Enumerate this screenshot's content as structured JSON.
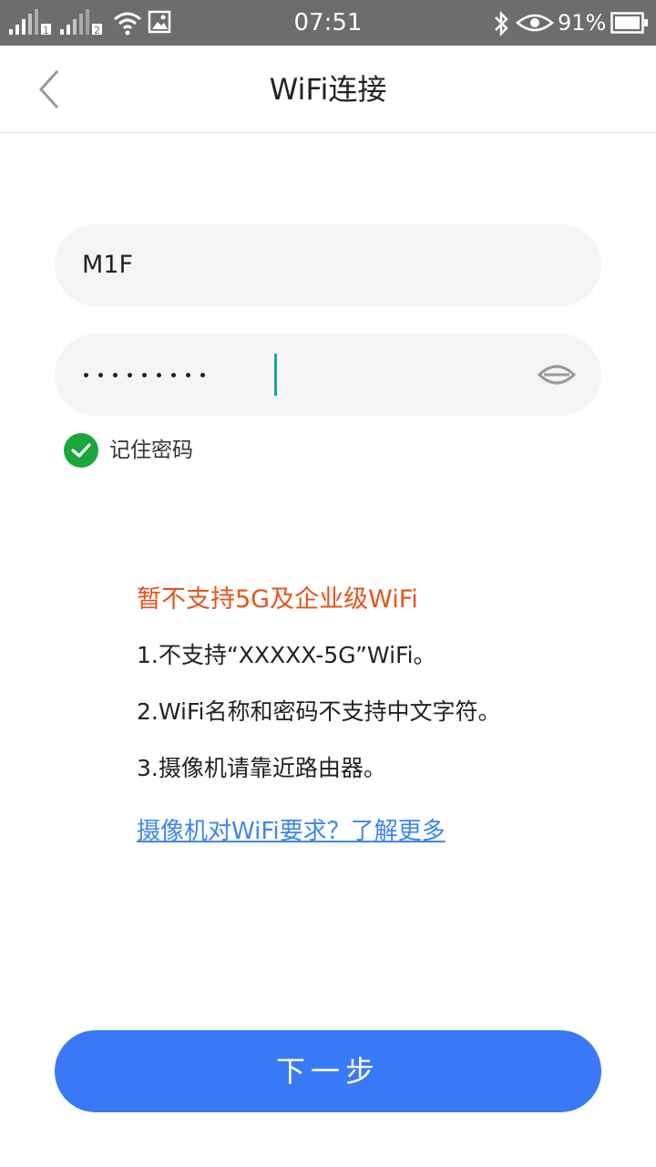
{
  "status_bar": {
    "time": "07:51",
    "battery": "91%",
    "sim1": "1",
    "sim2": "2",
    "icons": [
      "signal-icon",
      "wifi-icon",
      "image-icon",
      "bluetooth-icon",
      "eye-icon",
      "battery-icon"
    ]
  },
  "header": {
    "title": "WiFi连接",
    "back_icon": "chevron-left-icon"
  },
  "form": {
    "ssid_value": "M1F",
    "password_masked_count": 9,
    "password_visibility_icon": "eye-icon",
    "remember_label": "记住密码",
    "remember_checked": true
  },
  "notice": {
    "warning": "暂不支持5G及企业级WiFi",
    "tips": [
      "1.不支持“XXXXX-5G”WiFi。",
      "2.WiFi名称和密码不支持中文字符。",
      "3.摄像机请靠近路由器。"
    ]
  },
  "link": {
    "learn_more": "摄像机对WiFi要求？了解更多"
  },
  "actions": {
    "next": "下一步"
  },
  "colors": {
    "status_bar": "#6d6d6d",
    "primary": "#3a79f5",
    "warning": "#e8531c",
    "link": "#3d85f0",
    "check": "#1aa63a",
    "caret": "#1aa58f",
    "field_bg": "#f5f5f5"
  }
}
